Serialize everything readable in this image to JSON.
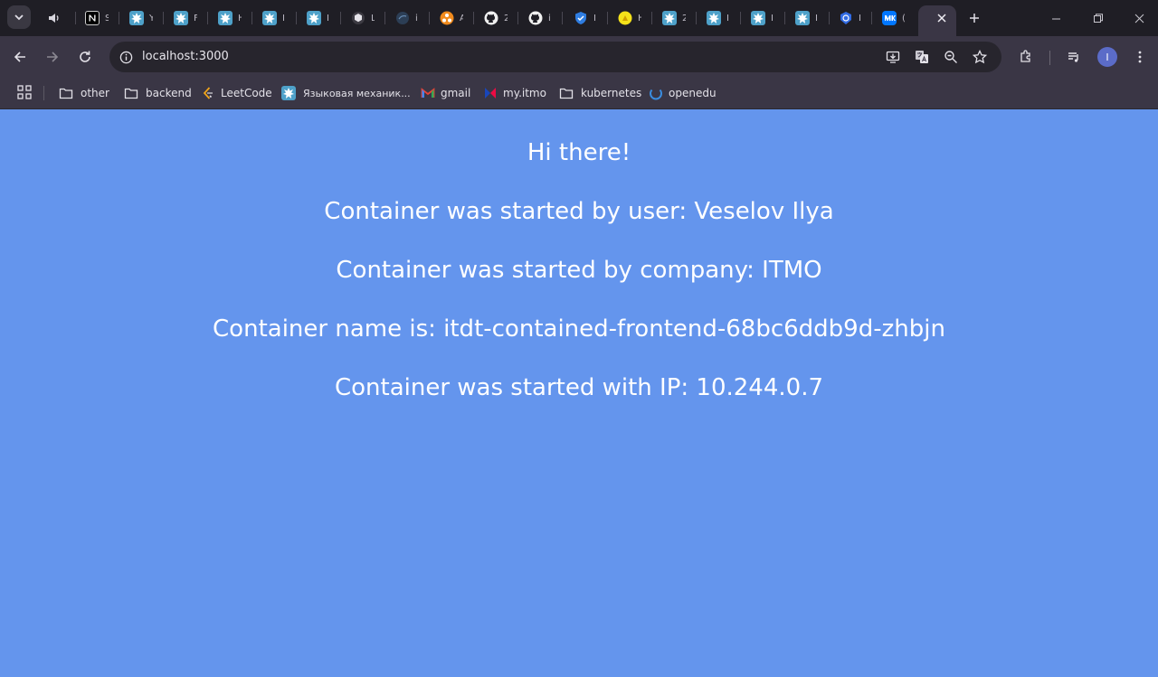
{
  "browser": {
    "tabs": [
      {
        "icon": "audio-icon",
        "title": ""
      },
      {
        "icon": "notion-icon",
        "title": "S"
      },
      {
        "icon": "confluence-icon",
        "title": "Y"
      },
      {
        "icon": "confluence-icon",
        "title": "F"
      },
      {
        "icon": "confluence-icon",
        "title": "H"
      },
      {
        "icon": "confluence-icon",
        "title": "I"
      },
      {
        "icon": "confluence-icon",
        "title": "I"
      },
      {
        "icon": "cube-icon",
        "title": "L"
      },
      {
        "icon": "globe-icon",
        "title": "i"
      },
      {
        "icon": "triangle-icon",
        "title": "A"
      },
      {
        "icon": "github-icon",
        "title": "2"
      },
      {
        "icon": "github-icon",
        "title": "i"
      },
      {
        "icon": "shield-icon",
        "title": "I"
      },
      {
        "icon": "yellow-circle-icon",
        "title": "H"
      },
      {
        "icon": "confluence-icon",
        "title": "2"
      },
      {
        "icon": "confluence-icon",
        "title": "I"
      },
      {
        "icon": "confluence-icon",
        "title": "I"
      },
      {
        "icon": "confluence-icon",
        "title": "I"
      },
      {
        "icon": "kubernetes-icon",
        "title": "I"
      },
      {
        "icon": "vk-icon",
        "title": "("
      }
    ],
    "address": "localhost:3000",
    "avatar_letter": "I",
    "bookmarks": [
      {
        "icon": "folder-icon",
        "label": "other"
      },
      {
        "icon": "folder-icon",
        "label": "backend"
      },
      {
        "icon": "leetcode-icon",
        "label": "LeetCode"
      },
      {
        "icon": "confluence-icon",
        "label": "Языковая механик..."
      },
      {
        "icon": "gmail-icon",
        "label": "gmail"
      },
      {
        "icon": "itmo-icon",
        "label": "my.itmo"
      },
      {
        "icon": "folder-icon",
        "label": "kubernetes"
      },
      {
        "icon": "openedu-icon",
        "label": "openedu"
      }
    ]
  },
  "page": {
    "greeting": "Hi there!",
    "user_line": "Container was started by user: Veselov Ilya",
    "company_line": "Container was started by company: ITMO",
    "name_line": "Container name is: itdt-contained-frontend-68bc6ddb9d-zhbjn",
    "ip_line": "Container was started with IP: 10.244.0.7"
  },
  "colors": {
    "page_background": "#6495ed",
    "page_text": "#ffffff",
    "tabstrip": "#1f1e25",
    "toolbar": "#3a3645"
  }
}
